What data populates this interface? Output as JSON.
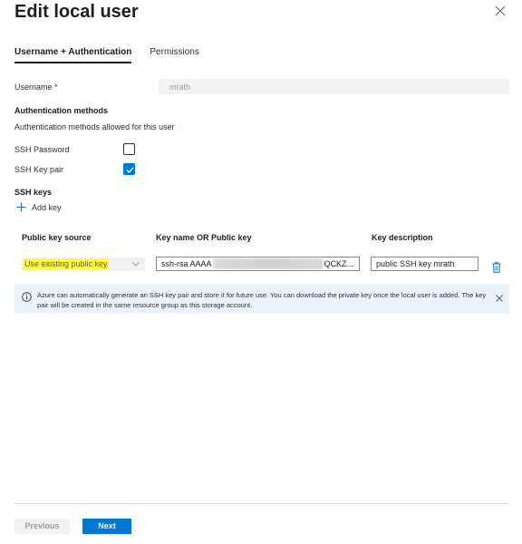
{
  "dialog": {
    "title": "Edit local user"
  },
  "tabs": [
    {
      "label": "Username + Authentication",
      "active": true
    },
    {
      "label": "Permissions",
      "active": false
    }
  ],
  "username": {
    "label": "Username *",
    "value": "mrath"
  },
  "auth": {
    "heading": "Authentication methods",
    "description": "Authentication methods allowed for this user",
    "ssh_password": {
      "label": "SSH Password",
      "checked": false
    },
    "ssh_keypair": {
      "label": "SSH Key pair",
      "checked": true
    }
  },
  "ssh_keys": {
    "heading": "SSH keys",
    "add_label": "Add key",
    "columns": [
      "Public key source",
      "Key name OR Public key",
      "Key description"
    ],
    "row": {
      "source": "Use existing public key",
      "key_prefix": "ssh-rsa AAAA",
      "key_suffix": "QCKZ...",
      "description": "public SSH key mrath"
    }
  },
  "info": {
    "message": "Azure can automatically generate an SSH key pair and store it for future use. You can download the private key once the local user is added. The key pair will be created in the same resource group as this storage account."
  },
  "footer": {
    "previous": "Previous",
    "next": "Next"
  },
  "colors": {
    "accent": "#0078d4",
    "highlight": "#fffb3d",
    "info_bg": "#eaf3fc"
  }
}
